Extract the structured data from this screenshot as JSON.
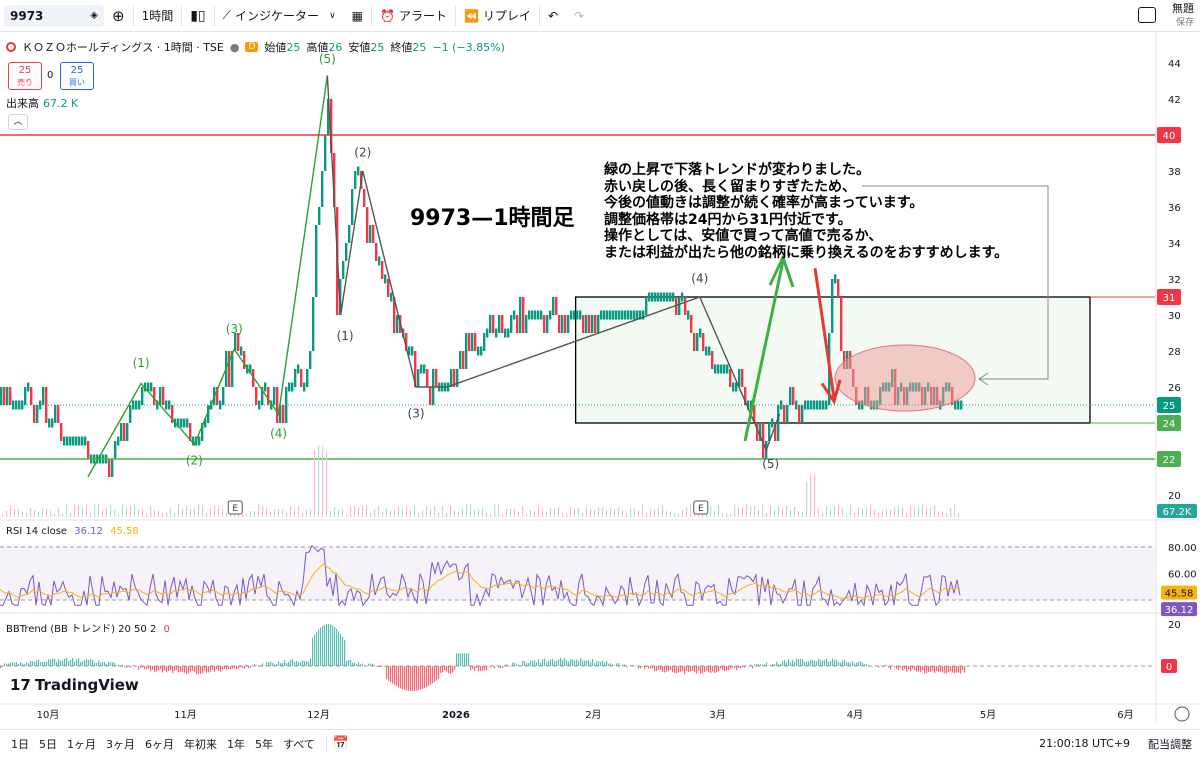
{
  "toolbar": {
    "symbol": "9973",
    "interval": "1時間",
    "indicators": "インジケーター",
    "alert": "アラート",
    "replay": "リプレイ",
    "layout_name": "無題",
    "save_label": "保存"
  },
  "legend": {
    "title": "ＫＯＺＯホールディングス · 1時間 · TSE",
    "badge": "D",
    "open_label": "始値",
    "open": "25",
    "high_label": "高値",
    "high": "26",
    "low_label": "安値",
    "low": "25",
    "close_label": "終値",
    "close": "25",
    "change": "−1 (−3.85%)",
    "sell_price": "25",
    "sell_label": "売り",
    "spread": "0",
    "buy_price": "25",
    "buy_label": "買い",
    "volume_label": "出来高",
    "volume": "67.2 K"
  },
  "annotation": {
    "lines": [
      "緑の上昇で下落トレンドが変わりました。",
      "赤い戻しの後、長く留まりすぎたため、",
      "今後の値動きは調整が続く確率が高まっています。",
      "調整価格帯は24円から31円付近です。",
      "操作としては、安値で買って高値で売るか、",
      "または利益が出たら他の銘柄に乗り換えるのをおすすめします。"
    ],
    "title": "9973—1時間足"
  },
  "rsi": {
    "label": "RSI 14 close",
    "value": "36.12",
    "ma": "45.58",
    "levels": [
      "80.00",
      "60.00"
    ]
  },
  "bbtrend": {
    "label": "BBTrend (BB トレンド) 20 50 2",
    "value": "0",
    "levels": [
      "20",
      "0"
    ]
  },
  "bottom": {
    "ranges": [
      "1日",
      "5日",
      "1ヶ月",
      "3ヶ月",
      "6ヶ月",
      "年初来",
      "1年",
      "5年",
      "すべて"
    ],
    "clock": "21:00:18 UTC+9",
    "adjust": "配当調整"
  },
  "branding": "TradingView",
  "colors": {
    "up": "#089981",
    "down": "#f23645",
    "wave_green": "#2ca02c",
    "rsi": "#7e57c2",
    "rsi_ma": "#f9b208"
  },
  "chart_data": {
    "type": "candlestick",
    "symbol": "9973",
    "price_axis": {
      "ticks": [
        20,
        22,
        24,
        26,
        28,
        30,
        32,
        34,
        36,
        38,
        40,
        42,
        44
      ],
      "range": [
        19,
        45
      ]
    },
    "time_axis": {
      "ticks": [
        "10月",
        "11月",
        "12月",
        "2026",
        "2月",
        "3月",
        "4月",
        "5月",
        "6月"
      ]
    },
    "price_path": [
      {
        "t": "2025-09-25",
        "p": 26
      },
      {
        "t": "2025-10-05",
        "p": 23
      },
      {
        "t": "2025-10-15",
        "p": 22
      },
      {
        "t": "2025-10-22",
        "p": 26.2
      },
      {
        "t": "2025-11-03",
        "p": 23
      },
      {
        "t": "2025-11-12",
        "p": 28
      },
      {
        "t": "2025-11-20",
        "p": 25
      },
      {
        "t": "2025-11-28",
        "p": 26
      },
      {
        "t": "2025-12-03",
        "p": 43
      },
      {
        "t": "2025-12-05",
        "p": 30
      },
      {
        "t": "2025-12-09",
        "p": 38
      },
      {
        "t": "2025-12-14",
        "p": 33
      },
      {
        "t": "2025-12-22",
        "p": 27
      },
      {
        "t": "2025-12-28",
        "p": 26
      },
      {
        "t": "2026-01-05",
        "p": 28
      },
      {
        "t": "2026-01-12",
        "p": 30
      },
      {
        "t": "2026-01-20",
        "p": 30
      },
      {
        "t": "2026-02-05",
        "p": 30
      },
      {
        "t": "2026-02-20",
        "p": 31
      },
      {
        "t": "2026-02-25",
        "p": 28
      },
      {
        "t": "2026-03-05",
        "p": 26
      },
      {
        "t": "2026-03-12",
        "p": 23
      },
      {
        "t": "2026-03-15",
        "p": 25
      },
      {
        "t": "2026-03-25",
        "p": 25
      },
      {
        "t": "2026-03-27",
        "p": 33
      },
      {
        "t": "2026-03-29",
        "p": 27
      },
      {
        "t": "2026-04-02",
        "p": 25
      },
      {
        "t": "2026-04-10",
        "p": 26
      },
      {
        "t": "2026-04-20",
        "p": 26
      },
      {
        "t": "2026-04-25",
        "p": 25
      }
    ],
    "horizontal_lines": [
      {
        "price": 40,
        "label": "40",
        "color": "#f23645"
      },
      {
        "price": 31,
        "label": "31",
        "color": "#f23645"
      },
      {
        "price": 25,
        "label": "25",
        "color": "#089981"
      },
      {
        "price": 24,
        "label": "24",
        "color": "#4caf50"
      },
      {
        "price": 22,
        "label": "22",
        "color": "#4caf50"
      }
    ],
    "last_volume": "67.2K",
    "waves_green": [
      "(1)",
      "(2)",
      "(3)",
      "(4)",
      "(5)"
    ],
    "waves_gray": [
      "(1)",
      "(2)",
      "(3)",
      "(4)",
      "(5)"
    ],
    "zone": {
      "from": "2026-01-28",
      "to": "2026-05-24",
      "low": 24,
      "high": 31
    },
    "events": [
      "E",
      "E"
    ],
    "rsi_current": 36.12,
    "rsi_ma_current": 45.58,
    "bbtrend_current": 0
  }
}
